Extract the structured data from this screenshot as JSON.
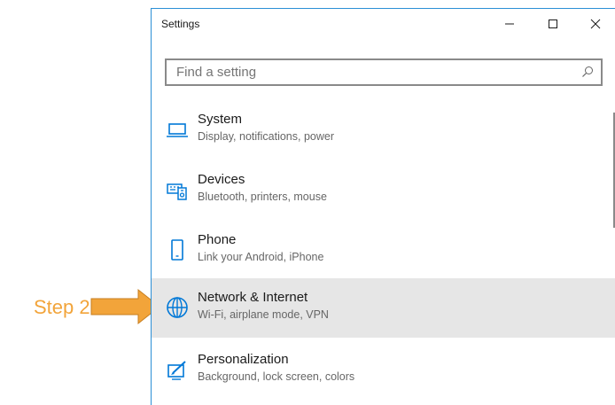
{
  "annotation": {
    "step_label": "Step 2",
    "arrow_color": "#f2a43a"
  },
  "window": {
    "title": "Settings",
    "controls": {
      "minimize": "minimize-icon",
      "maximize": "maximize-icon",
      "close": "close-icon"
    }
  },
  "search": {
    "placeholder": "Find a setting",
    "icon": "search-icon"
  },
  "categories": [
    {
      "title": "System",
      "subtitle": "Display, notifications, power",
      "icon": "laptop-icon",
      "selected": false
    },
    {
      "title": "Devices",
      "subtitle": "Bluetooth, printers, mouse",
      "icon": "devices-icon",
      "selected": false
    },
    {
      "title": "Phone",
      "subtitle": "Link your Android, iPhone",
      "icon": "phone-icon",
      "selected": false
    },
    {
      "title": "Network & Internet",
      "subtitle": "Wi-Fi, airplane mode, VPN",
      "icon": "globe-icon",
      "selected": true
    },
    {
      "title": "Personalization",
      "subtitle": "Background, lock screen, colors",
      "icon": "paint-icon",
      "selected": false
    }
  ],
  "colors": {
    "accent": "#0078d7",
    "selected_bg": "#e6e6e6",
    "window_border": "#2b8fd6"
  }
}
